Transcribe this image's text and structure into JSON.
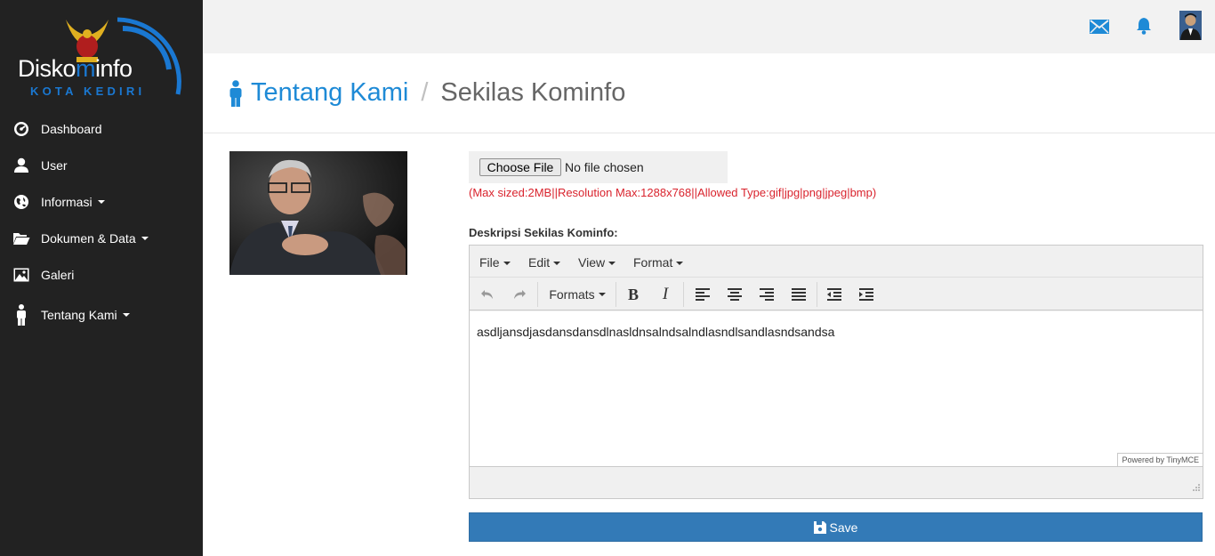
{
  "brand": {
    "name_part1": "Disko",
    "name_part2": "m",
    "name_part3": "info",
    "subtitle": "KOTA KEDIRI"
  },
  "sidebar": {
    "items": [
      {
        "label": "Dashboard",
        "icon": "dashboard-icon",
        "has_caret": false
      },
      {
        "label": "User",
        "icon": "user-icon",
        "has_caret": false
      },
      {
        "label": "Informasi",
        "icon": "globe-icon",
        "has_caret": true
      },
      {
        "label": "Dokumen & Data",
        "icon": "folder-open-icon",
        "has_caret": true
      },
      {
        "label": "Galeri",
        "icon": "picture-icon",
        "has_caret": false
      },
      {
        "label": "Tentang Kami",
        "icon": "person-icon",
        "has_caret": true
      }
    ]
  },
  "topbar": {
    "icons": [
      "mail-icon",
      "bell-icon",
      "avatar"
    ]
  },
  "breadcrumb": {
    "parent": "Tentang Kami",
    "separator": "/",
    "current": "Sekilas Kominfo"
  },
  "upload": {
    "button_label": "Choose File",
    "status": "No file chosen",
    "hint": "(Max sized:2MB||Resolution Max:1288x768||Allowed Type:gif|jpg|png|jpeg|bmp)"
  },
  "description": {
    "label": "Deskripsi Sekilas Kominfo:"
  },
  "editor": {
    "menus": [
      "File",
      "Edit",
      "View",
      "Format"
    ],
    "formats_label": "Formats",
    "content": "asdljansdjasdansdansdlnasldnsalndsalndlasndlsandlasndsandsa",
    "powered_by": "Powered by TinyMCE"
  },
  "actions": {
    "save_label": "Save"
  },
  "colors": {
    "sidebar_bg": "#222222",
    "accent": "#1e8ad6",
    "primary_button": "#337ab7",
    "hint_red": "#d9232d"
  }
}
